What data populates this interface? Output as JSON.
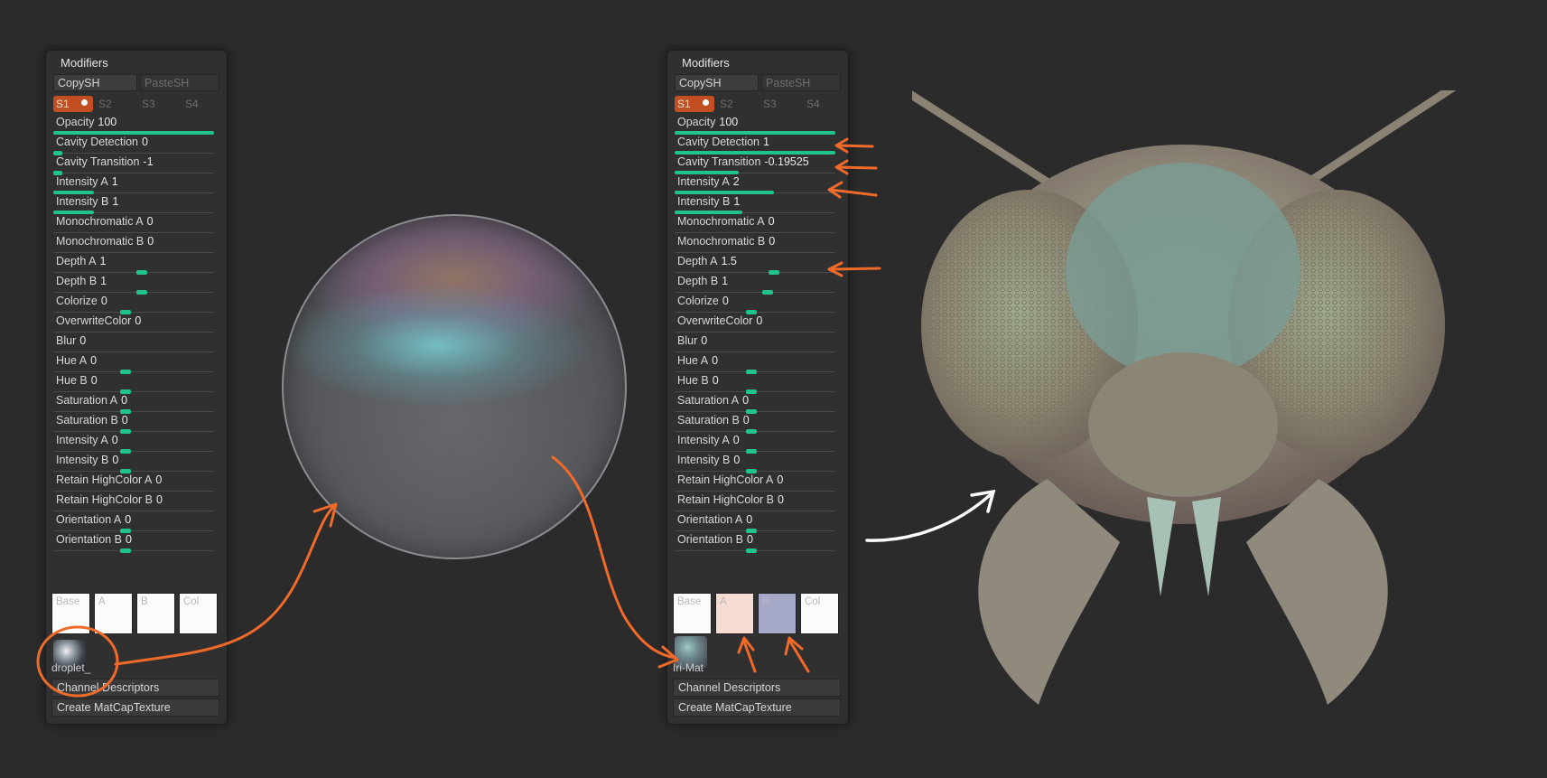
{
  "panels": [
    {
      "title": "Modifiers",
      "copy_label": "CopySH",
      "paste_label": "PasteSH",
      "slots": [
        "S1",
        "S2",
        "S3",
        "S4"
      ],
      "rows": [
        {
          "label": "Opacity",
          "value": "100",
          "level": 1.0
        },
        {
          "label": "Cavity Detection",
          "value": "0",
          "level": 0.0
        },
        {
          "label": "Cavity Transition",
          "value": "-1",
          "level": 0.0
        },
        {
          "label": "Intensity A",
          "value": "1",
          "level": 0.25
        },
        {
          "label": "Intensity B",
          "value": "1",
          "level": 0.25
        },
        {
          "label": "Monochromatic A",
          "value": "0",
          "level": 0.0
        },
        {
          "label": "Monochromatic B",
          "value": "0",
          "level": 0.0
        },
        {
          "label": "Depth A",
          "value": "1",
          "level": 0.55
        },
        {
          "label": "Depth B",
          "value": "1",
          "level": 0.55
        },
        {
          "label": "Colorize",
          "value": "0",
          "level": 0.45
        },
        {
          "label": "OverwriteColor",
          "value": "0",
          "level": 0.0
        },
        {
          "label": "Blur",
          "value": "0",
          "level": 0.0
        },
        {
          "label": "Hue A",
          "value": "0",
          "level": 0.45
        },
        {
          "label": "Hue B",
          "value": "0",
          "level": 0.45
        },
        {
          "label": "Saturation A",
          "value": "0",
          "level": 0.45
        },
        {
          "label": "Saturation B",
          "value": "0",
          "level": 0.45
        },
        {
          "label": "Intensity A",
          "value": "0",
          "level": 0.45
        },
        {
          "label": "Intensity B",
          "value": "0",
          "level": 0.45
        },
        {
          "label": "Retain HighColor A",
          "value": "0",
          "level": 0.0
        },
        {
          "label": "Retain HighColor B",
          "value": "0",
          "level": 0.0
        },
        {
          "label": "Orientation A",
          "value": "0",
          "level": 0.45
        },
        {
          "label": "Orientation B",
          "value": "0",
          "level": 0.45
        }
      ],
      "swatches": [
        {
          "label": "Base",
          "color": "#fbfbfb"
        },
        {
          "label": "A",
          "color": "#fbfbfb"
        },
        {
          "label": "B",
          "color": "#fbfbfb"
        },
        {
          "label": "Col",
          "color": "#fbfbfb"
        }
      ],
      "matcap_name": "droplet_",
      "channel_label": "Channel Descriptors",
      "create_label": "Create MatCapTexture"
    },
    {
      "title": "Modifiers",
      "copy_label": "CopySH",
      "paste_label": "PasteSH",
      "slots": [
        "S1",
        "S2",
        "S3",
        "S4"
      ],
      "rows": [
        {
          "label": "Opacity",
          "value": "100",
          "level": 1.0
        },
        {
          "label": "Cavity Detection",
          "value": "1",
          "level": 1.0
        },
        {
          "label": "Cavity Transition",
          "value": "-0.19525",
          "level": 0.4
        },
        {
          "label": "Intensity A",
          "value": "2",
          "level": 0.62
        },
        {
          "label": "Intensity B",
          "value": "1",
          "level": 0.42
        },
        {
          "label": "Monochromatic A",
          "value": "0",
          "level": 0.0
        },
        {
          "label": "Monochromatic B",
          "value": "0",
          "level": 0.0
        },
        {
          "label": "Depth A",
          "value": "1.5",
          "level": 0.62
        },
        {
          "label": "Depth B",
          "value": "1",
          "level": 0.58
        },
        {
          "label": "Colorize",
          "value": "0",
          "level": 0.48
        },
        {
          "label": "OverwriteColor",
          "value": "0",
          "level": 0.0
        },
        {
          "label": "Blur",
          "value": "0",
          "level": 0.0
        },
        {
          "label": "Hue A",
          "value": "0",
          "level": 0.48
        },
        {
          "label": "Hue B",
          "value": "0",
          "level": 0.48
        },
        {
          "label": "Saturation A",
          "value": "0",
          "level": 0.48
        },
        {
          "label": "Saturation B",
          "value": "0",
          "level": 0.48
        },
        {
          "label": "Intensity A",
          "value": "0",
          "level": 0.48
        },
        {
          "label": "Intensity B",
          "value": "0",
          "level": 0.48
        },
        {
          "label": "Retain HighColor A",
          "value": "0",
          "level": 0.0
        },
        {
          "label": "Retain HighColor B",
          "value": "0",
          "level": 0.0
        },
        {
          "label": "Orientation A",
          "value": "0",
          "level": 0.48
        },
        {
          "label": "Orientation B",
          "value": "0",
          "level": 0.48
        }
      ],
      "swatches": [
        {
          "label": "Base",
          "color": "#fbfbfb"
        },
        {
          "label": "A",
          "color": "#f6dcd2"
        },
        {
          "label": "B",
          "color": "#a6a8c8"
        },
        {
          "label": "Col",
          "color": "#fbfbfb"
        }
      ],
      "matcap_name": "Iri-Mat",
      "channel_label": "Channel Descriptors",
      "create_label": "Create MatCapTexture"
    }
  ],
  "colors": {
    "slider_accent": "#1fc38b",
    "active_slot": "#c34e22",
    "annotation_arrow": "#f06a2a",
    "annotation_arrow_white": "#ffffff"
  }
}
